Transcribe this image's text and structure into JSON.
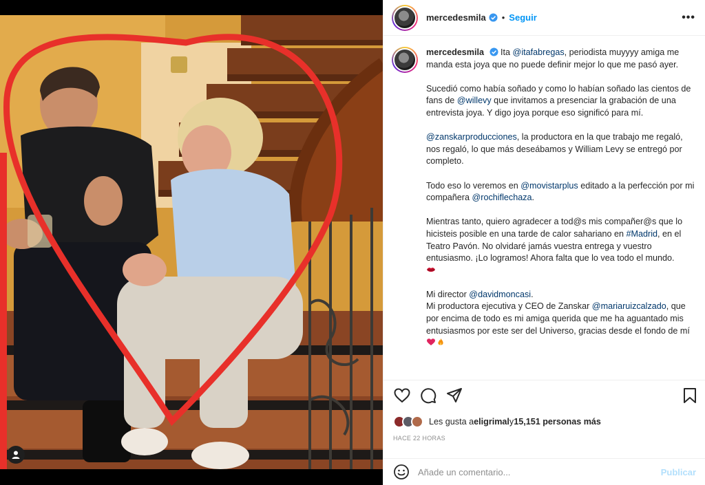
{
  "header": {
    "username": "mercedesmila",
    "separator": "•",
    "follow_label": "Seguir",
    "more_label": "•••"
  },
  "caption": {
    "username": "mercedesmila",
    "p1": {
      "t1": "Ita ",
      "m1": "@itafabregas",
      "t2": ", periodista muyyyy amiga me manda esta joya que no puede definir mejor lo que me pasó ayer."
    },
    "p2": {
      "t1": "Sucedió como había soñado y como lo habían soñado las cientos de fans de ",
      "m1": "@willevy",
      "t2": " que invitamos a presenciar la grabación de una entrevista joya. Y digo joya porque eso significó para mí."
    },
    "p3": {
      "m1": "@zanskarproducciones",
      "t1": ", la productora en la que trabajo me regaló, nos regaló, lo que más deseábamos y William Levy se entregó por completo."
    },
    "p4": {
      "t1": "Todo eso lo veremos en ",
      "m1": "@movistarplus",
      "t2": " editado a la perfección por mi compañera ",
      "m2": "@rochiflechaza",
      "t3": "."
    },
    "p5": {
      "t1": "Mientras tanto, quiero agradecer a tod@s mis compañer@s que lo hicisteis posible en una tarde de calor sahariano en ",
      "m1": "#Madrid",
      "t2": ", en el Teatro Pavón. No olvidaré jamás vuestra entrega y vuestro entusiasmo. ¡Lo logramos! Ahora falta que lo vea todo el mundo."
    },
    "p6": {
      "t1": "Mi director ",
      "m1": "@davidmoncasi",
      "t2": ".",
      "t3": "Mi productora ejecutiva y CEO de Zanskar ",
      "m2": "@mariaruizcalzado",
      "t4": ", que por encima de todo es mi amiga querida que me ha aguantado mis entusiasmos por este ser del Universo, gracias desde el fondo de mí "
    }
  },
  "likes": {
    "prefix": "Les gusta a ",
    "user": "eligrimal",
    "middle": " y ",
    "count": "15,151 personas más"
  },
  "timestamp": "HACE 22 HORAS",
  "comment": {
    "placeholder": "Añade un comentario...",
    "post_label": "Publicar"
  },
  "icons": {
    "like": "heart-outline-icon",
    "comment": "speech-bubble-icon",
    "share": "paper-plane-icon",
    "save": "bookmark-icon",
    "emoji": "smiley-icon",
    "verified": "verified-badge-icon"
  },
  "colors": {
    "accent": "#0095f6",
    "mention": "#00376b",
    "muted": "#8e8e8e",
    "post_disabled": "#b2dffc",
    "heart_overlay": "#e8302a"
  }
}
